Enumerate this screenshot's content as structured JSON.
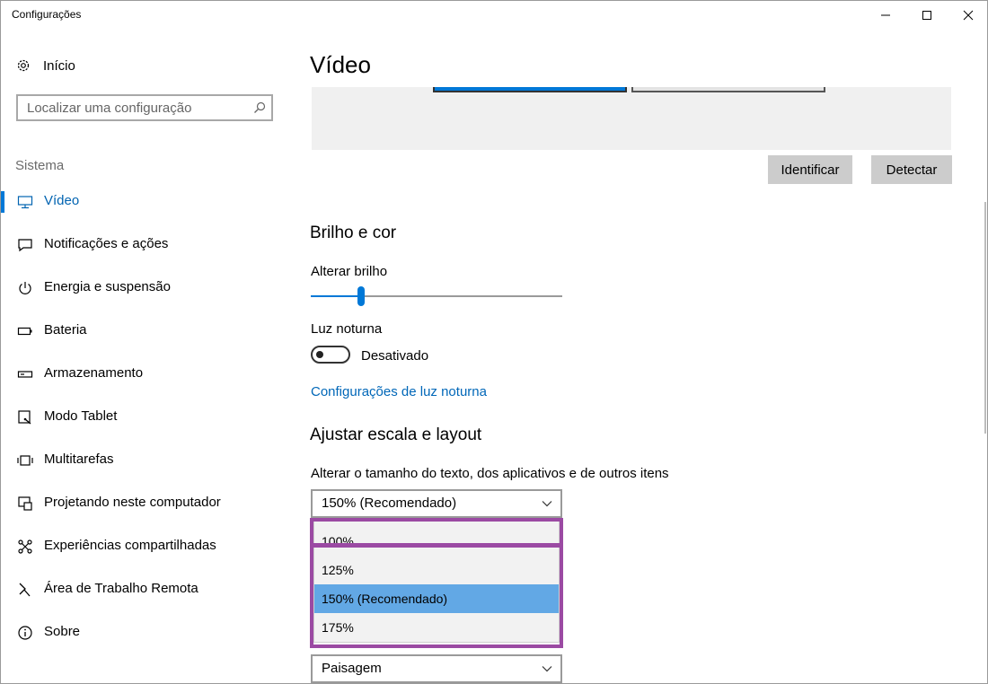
{
  "window": {
    "title": "Configurações"
  },
  "sidebar": {
    "home_label": "Início",
    "search_placeholder": "Localizar uma configuração",
    "section_label": "Sistema",
    "items": [
      {
        "label": "Vídeo",
        "icon": "monitor-icon",
        "active": true
      },
      {
        "label": "Notificações e ações",
        "icon": "notification-icon"
      },
      {
        "label": "Energia e suspensão",
        "icon": "power-icon"
      },
      {
        "label": "Bateria",
        "icon": "battery-icon"
      },
      {
        "label": "Armazenamento",
        "icon": "storage-icon"
      },
      {
        "label": "Modo Tablet",
        "icon": "tablet-icon"
      },
      {
        "label": "Multitarefas",
        "icon": "multitasking-icon"
      },
      {
        "label": "Projetando neste computador",
        "icon": "projecting-icon"
      },
      {
        "label": "Experiências compartilhadas",
        "icon": "share-icon"
      },
      {
        "label": "Área de Trabalho Remota",
        "icon": "remote-desktop-icon"
      },
      {
        "label": "Sobre",
        "icon": "info-icon"
      }
    ]
  },
  "main": {
    "title": "Vídeo",
    "buttons": {
      "identify": "Identificar",
      "detect": "Detectar"
    },
    "brightness": {
      "heading": "Brilho e cor",
      "label": "Alterar brilho",
      "level_percent": 20,
      "night_light_label": "Luz noturna",
      "night_light_state": "Desativado",
      "night_light_link": "Configurações de luz noturna"
    },
    "scale": {
      "heading": "Ajustar escala e layout",
      "label": "Alterar o tamanho do texto, dos aplicativos e de outros itens",
      "selected": "150% (Recomendado)",
      "options": [
        "100%",
        "125%",
        "150% (Recomendado)",
        "175%"
      ]
    },
    "orientation": {
      "selected": "Paisagem"
    }
  },
  "colors": {
    "accent": "#0078d7",
    "link": "#0067b8",
    "highlight": "#9b4aa3",
    "selected_option": "#62a8e5"
  }
}
